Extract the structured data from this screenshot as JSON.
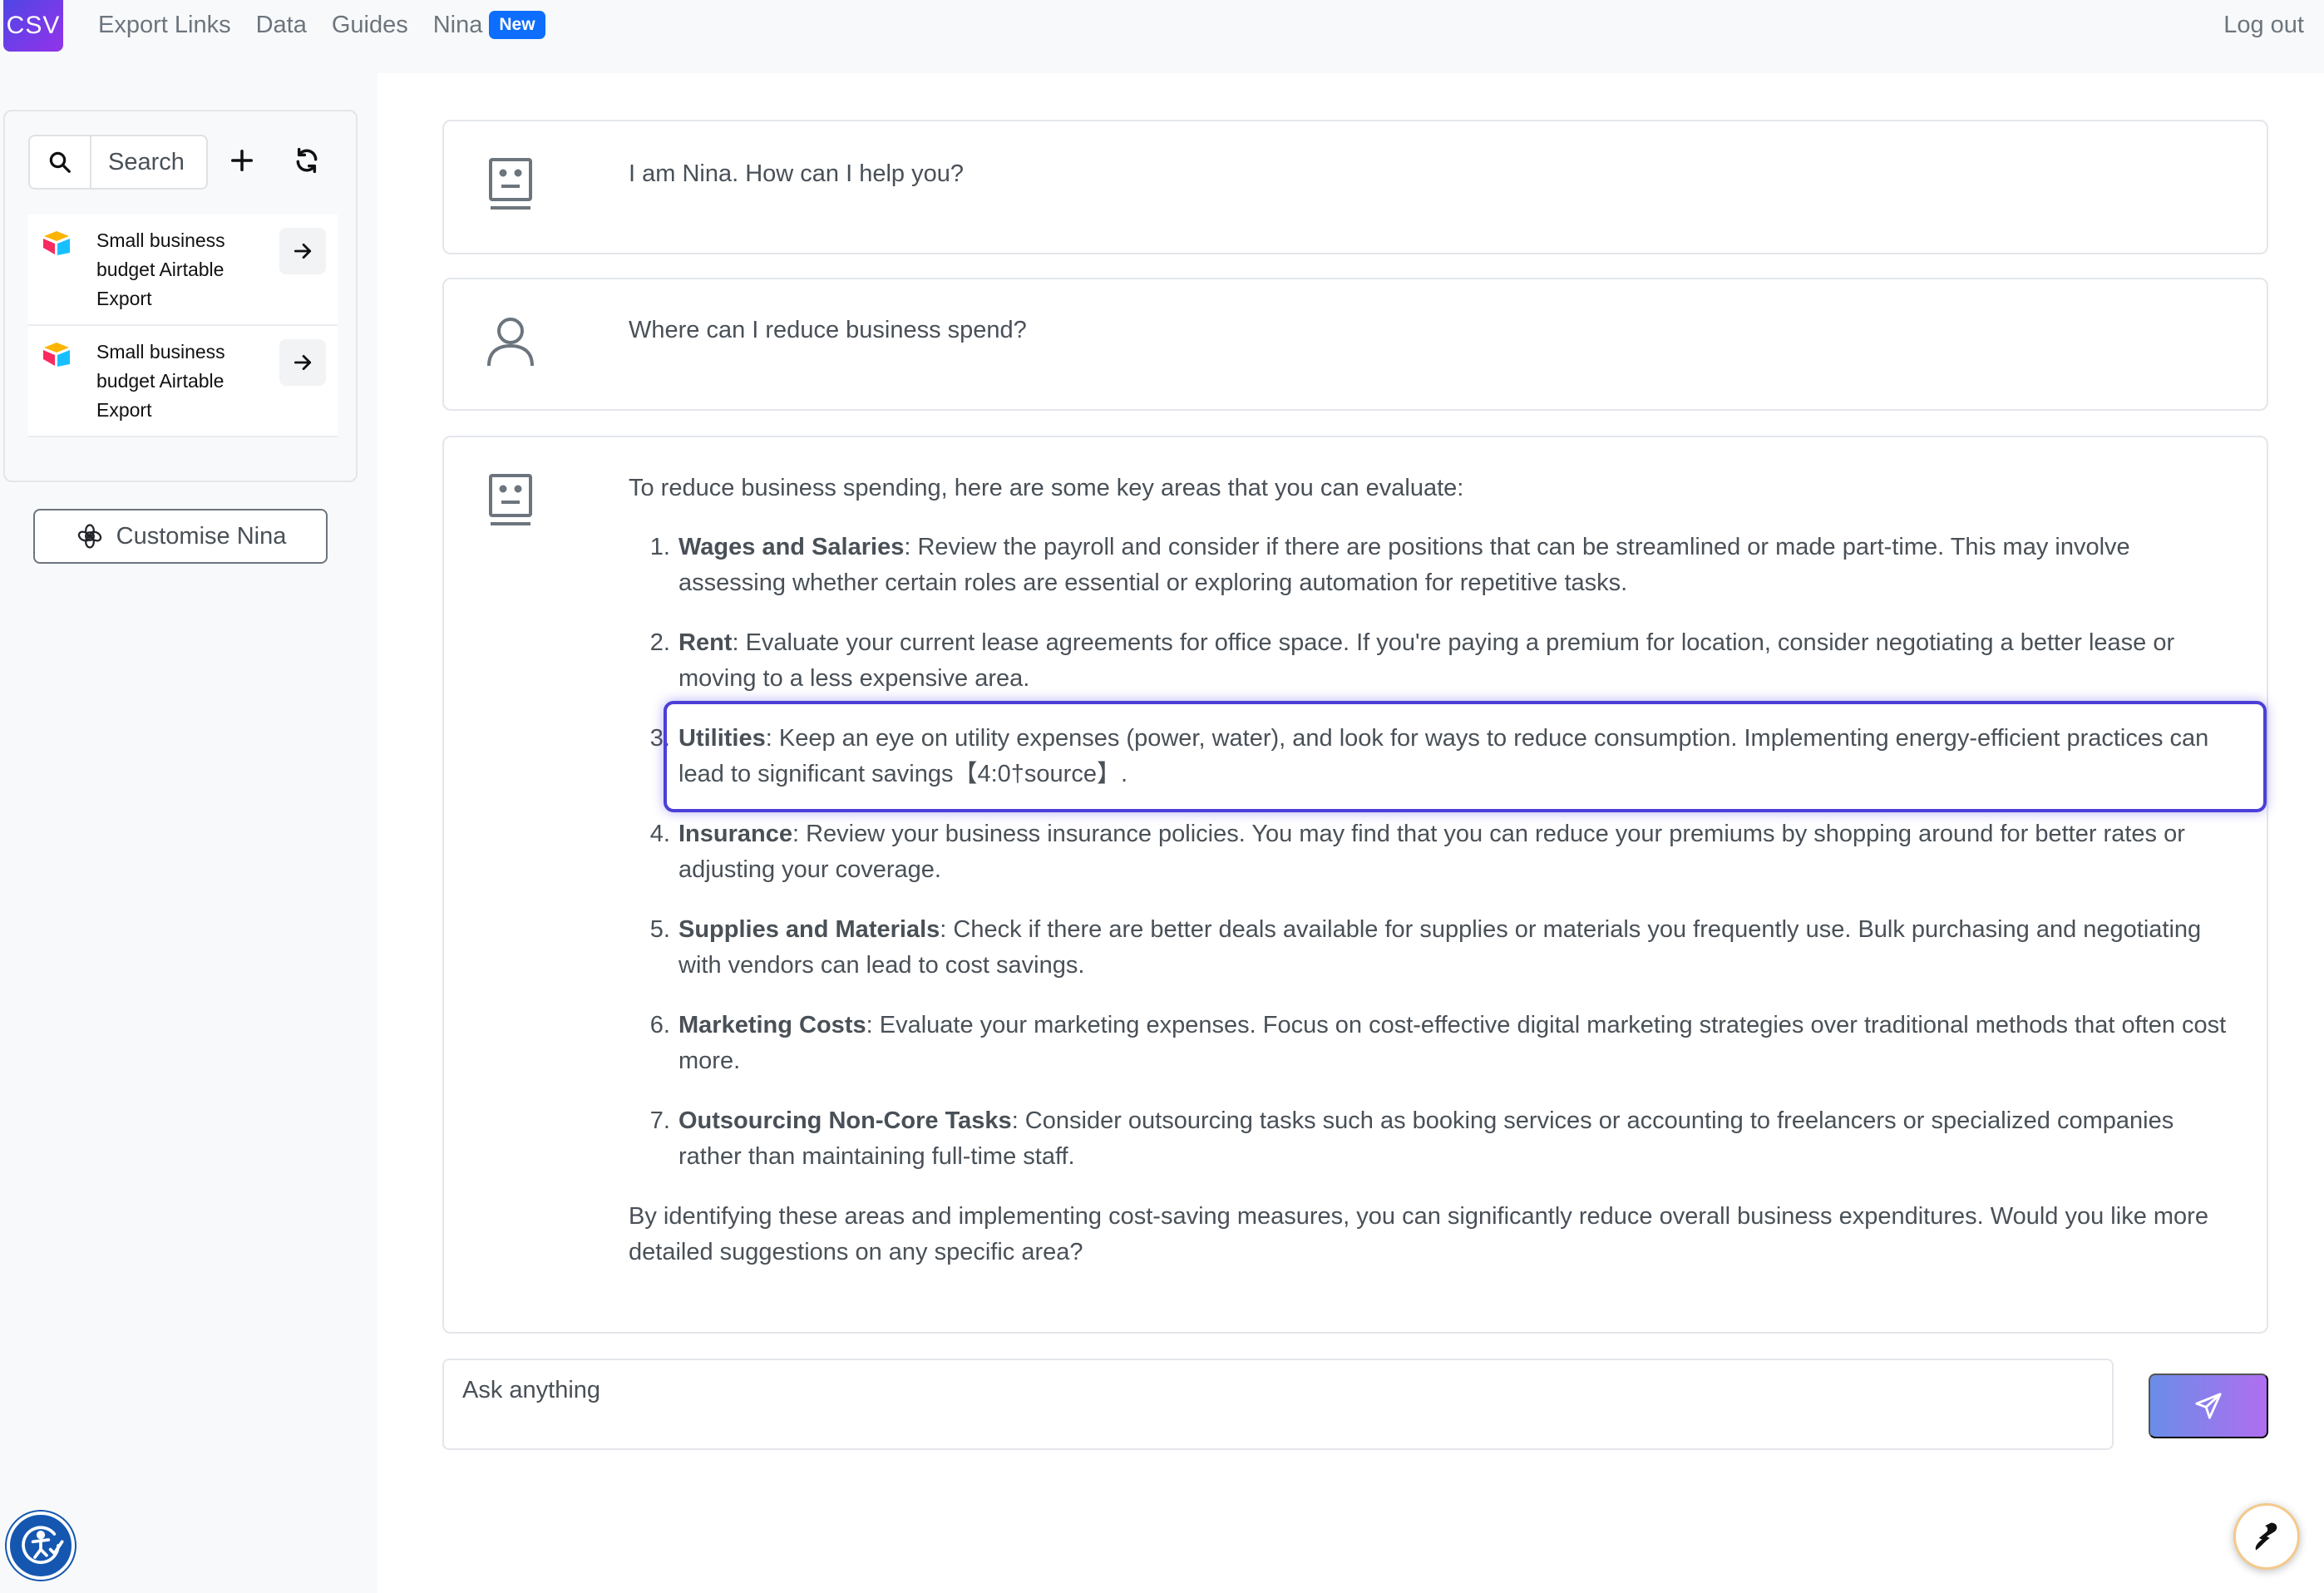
{
  "brand": {
    "label": "CSV",
    "colors": [
      "#4f46e5",
      "#9333ea"
    ]
  },
  "nav": {
    "links": [
      "Export Links",
      "Data",
      "Guides"
    ],
    "nina": "Nina",
    "nina_badge": "New",
    "logout": "Log out"
  },
  "sidebar": {
    "search_label": "Search",
    "icons": [
      "search-icon",
      "plus-icon",
      "refresh-icon"
    ],
    "files": [
      {
        "name": "Small business budget Airtable Export",
        "logo": "airtable-logo-icon"
      },
      {
        "name": "Small business budget Airtable Export",
        "logo": "airtable-logo-icon"
      }
    ],
    "customise_label": "Customise Nina"
  },
  "chat": {
    "messages": [
      {
        "role": "assistant",
        "icon": "robot-face-icon",
        "text": "I am Nina. How can I help you?"
      },
      {
        "role": "user",
        "icon": "user-icon",
        "text": "Where can I reduce business spend?"
      }
    ],
    "answer": {
      "role": "assistant",
      "icon": "robot-face-icon",
      "intro": "To reduce business spending, here are some key areas that you can evaluate:",
      "items": [
        {
          "title": "Wages and Salaries",
          "text": ": Review the payroll and consider if there are positions that can be streamlined or made part-time. This may involve assessing whether certain roles are essential or exploring automation for repetitive tasks."
        },
        {
          "title": "Rent",
          "text": ": Evaluate your current lease agreements for office space. If you're paying a premium for location, consider negotiating a better lease or moving to a less expensive area."
        },
        {
          "title": "Utilities",
          "text": ": Keep an eye on utility expenses (power, water), and look for ways to reduce consumption. Implementing energy-efficient practices can lead to significant savings【4:0†source】."
        },
        {
          "title": "Insurance",
          "text": ": Review your business insurance policies. You may find that you can reduce your premiums by shopping around for better rates or adjusting your coverage."
        },
        {
          "title": "Supplies and Materials",
          "text": ": Check if there are better deals available for supplies or materials you frequently use. Bulk purchasing and negotiating with vendors can lead to cost savings."
        },
        {
          "title": "Marketing Costs",
          "text": ": Evaluate your marketing expenses. Focus on cost-effective digital marketing strategies over traditional methods that often cost more."
        },
        {
          "title": "Outsourcing Non-Core Tasks",
          "text": ": Consider outsourcing tasks such as booking services or accounting to freelancers or specialized companies rather than maintaining full-time staff."
        }
      ],
      "highlighted_item_index": 2,
      "outro": "By identifying these areas and implementing cost-saving measures, you can significantly reduce overall business expenditures. Would you like more detailed suggestions on any specific area?"
    },
    "input_placeholder": "Ask anything",
    "send_icon": "send-icon",
    "accent_gradient": [
      "#6a8de8",
      "#b06ef0"
    ],
    "highlight_color": "#4b3fd8"
  },
  "widgets": {
    "accessibility_icon": "accessibility-icon",
    "help_icon": "help-widget-icon"
  }
}
